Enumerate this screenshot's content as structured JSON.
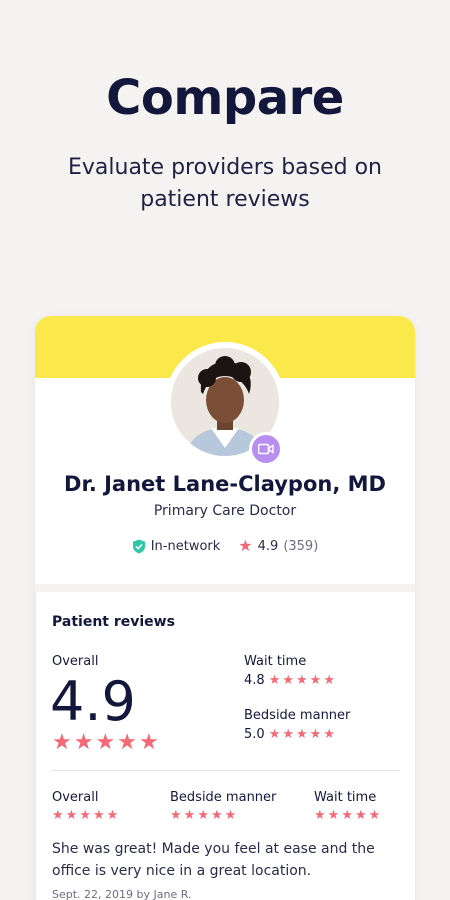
{
  "headline": "Compare",
  "subhead": "Evaluate providers based on patient reviews",
  "doctor": {
    "name": "Dr. Janet Lane-Claypon, MD",
    "specialty": "Primary Care Doctor",
    "network_label": "In-network",
    "rating": "4.9",
    "review_count": "(359)"
  },
  "reviews": {
    "title": "Patient reviews",
    "overall_label": "Overall",
    "overall_score": "4.9",
    "wait_time_label": "Wait time",
    "wait_time_score": "4.8",
    "bedside_label": "Bedside manner",
    "bedside_score": "5.0",
    "review": {
      "overall_label": "Overall",
      "bedside_label": "Bedside manner",
      "wait_label": "Wait time",
      "text": "She was great! Made you feel at ease and the office is very nice in a great location.",
      "date": "Sept. 22, 2019 by Jane R."
    }
  },
  "colors": {
    "accent_yellow": "#fbe94b",
    "star": "#f36a77",
    "video_badge": "#b88ef0",
    "check": "#2fc7a7"
  },
  "icons": [
    "video-icon",
    "verified-check-icon",
    "star-icon"
  ]
}
